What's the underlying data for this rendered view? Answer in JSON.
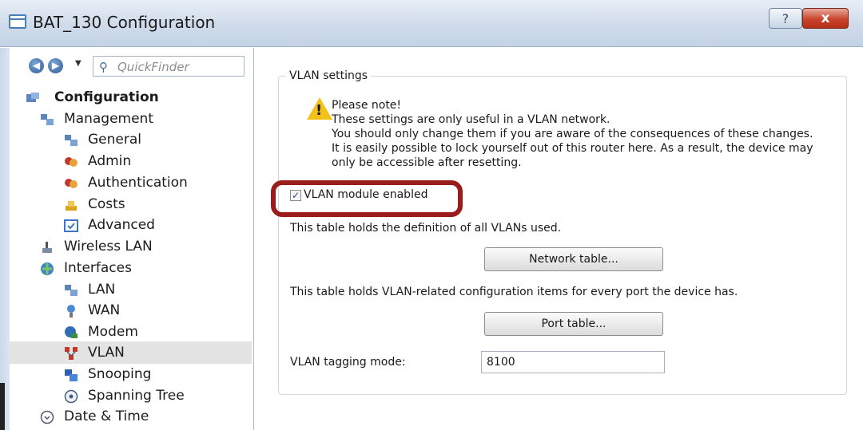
{
  "window": {
    "title": "BAT_130 Configuration",
    "help_label": "?",
    "close_label": "x"
  },
  "navbar": {
    "back_icon": "back-arrow-icon",
    "forward_icon": "forward-arrow-icon",
    "dropdown_glyph": "▼",
    "quickfinder_placeholder": "QuickFinder"
  },
  "tree": {
    "items": [
      {
        "label": "Configuration",
        "icon": "configuration-icon",
        "bold": true
      },
      {
        "label": "Management",
        "icon": "management-icon"
      },
      {
        "label": "General",
        "icon": "general-icon"
      },
      {
        "label": "Admin",
        "icon": "admin-icon"
      },
      {
        "label": "Authentication",
        "icon": "authentication-icon"
      },
      {
        "label": "Costs",
        "icon": "costs-icon"
      },
      {
        "label": "Advanced",
        "icon": "advanced-icon"
      },
      {
        "label": "Wireless LAN",
        "icon": "wireless-lan-icon"
      },
      {
        "label": "Interfaces",
        "icon": "interfaces-icon"
      },
      {
        "label": "LAN",
        "icon": "lan-icon"
      },
      {
        "label": "WAN",
        "icon": "wan-icon"
      },
      {
        "label": "Modem",
        "icon": "modem-icon"
      },
      {
        "label": "VLAN",
        "icon": "vlan-icon",
        "selected": true
      },
      {
        "label": "Snooping",
        "icon": "snooping-icon"
      },
      {
        "label": "Spanning Tree",
        "icon": "spanning-tree-icon"
      },
      {
        "label": "Date & Time",
        "icon": "date-time-icon"
      }
    ]
  },
  "vlan": {
    "group_title": "VLAN settings",
    "note_lines": [
      "Please note!",
      "These settings are only useful in a VLAN network.",
      "You should only change them if you are aware of the consequences of these changes.",
      "It is easily possible to lock yourself out of this router here. As a result, the device may",
      "only be accessible after resetting."
    ],
    "module_enabled_label": "VLAN module enabled",
    "module_enabled_checked": true,
    "network_table_desc": "This table holds the definition of all VLANs used.",
    "network_table_button": "Network table...",
    "port_table_desc": "This table holds VLAN-related configuration items for every port the device has.",
    "port_table_button": "Port table...",
    "tagging_mode_label": "VLAN tagging mode:",
    "tagging_mode_value": "8100"
  },
  "colors": {
    "highlight": "#9c1b1b",
    "selection": "#e3e3e3",
    "warning": "#f2c21b"
  }
}
